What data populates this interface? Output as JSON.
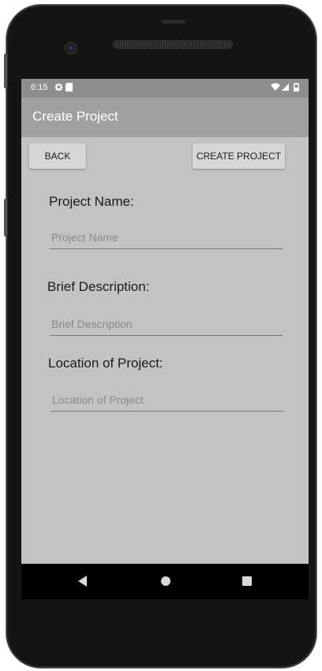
{
  "status_bar": {
    "time": "6:15",
    "settings_icon": "gear-icon",
    "sd_icon": "sd-card-icon",
    "wifi_icon": "wifi-icon",
    "signal_icon": "cell-signal-icon",
    "battery_icon": "battery-icon"
  },
  "app_bar": {
    "title": "Create Project"
  },
  "toolbar": {
    "back_label": "BACK",
    "create_label": "CREATE PROJECT"
  },
  "form": {
    "project_name": {
      "label": "Project Name:",
      "placeholder": "Project Name",
      "value": ""
    },
    "brief_description": {
      "label": "Brief Description:",
      "placeholder": "Brief Description",
      "value": ""
    },
    "location": {
      "label": "Location of Project:",
      "placeholder": "Location of Project",
      "value": ""
    }
  },
  "nav_bar": {
    "back_icon": "back-triangle-icon",
    "home_icon": "home-circle-icon",
    "recents_icon": "recents-square-icon"
  },
  "colors": {
    "status_bar": "#8e8e8e",
    "app_bar": "#a0a0a0",
    "content_background": "#c3c3c3",
    "button_background": "#d6d6d6"
  }
}
